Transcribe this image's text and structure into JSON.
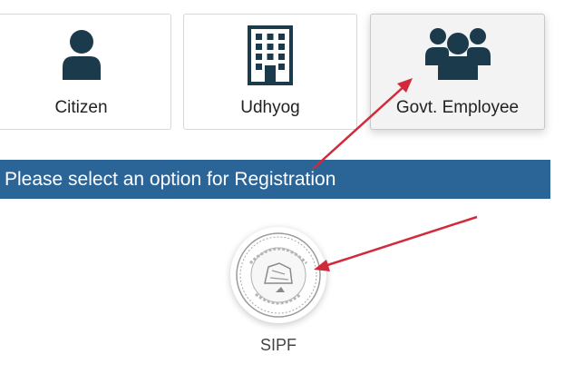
{
  "options": {
    "citizen": {
      "label": "Citizen",
      "icon": "person-icon"
    },
    "udhyog": {
      "label": "Udhyog",
      "icon": "building-icon"
    },
    "govt_employee": {
      "label": "Govt. Employee",
      "icon": "group-icon"
    }
  },
  "banner": {
    "text": "Please select an option for Registration"
  },
  "sipf": {
    "label": "SIPF",
    "icon": "sipf-emblem-icon"
  },
  "colors": {
    "banner_bg": "#2b6496",
    "icon_color": "#1b3a4b",
    "arrow_color": "#d12a3a"
  }
}
